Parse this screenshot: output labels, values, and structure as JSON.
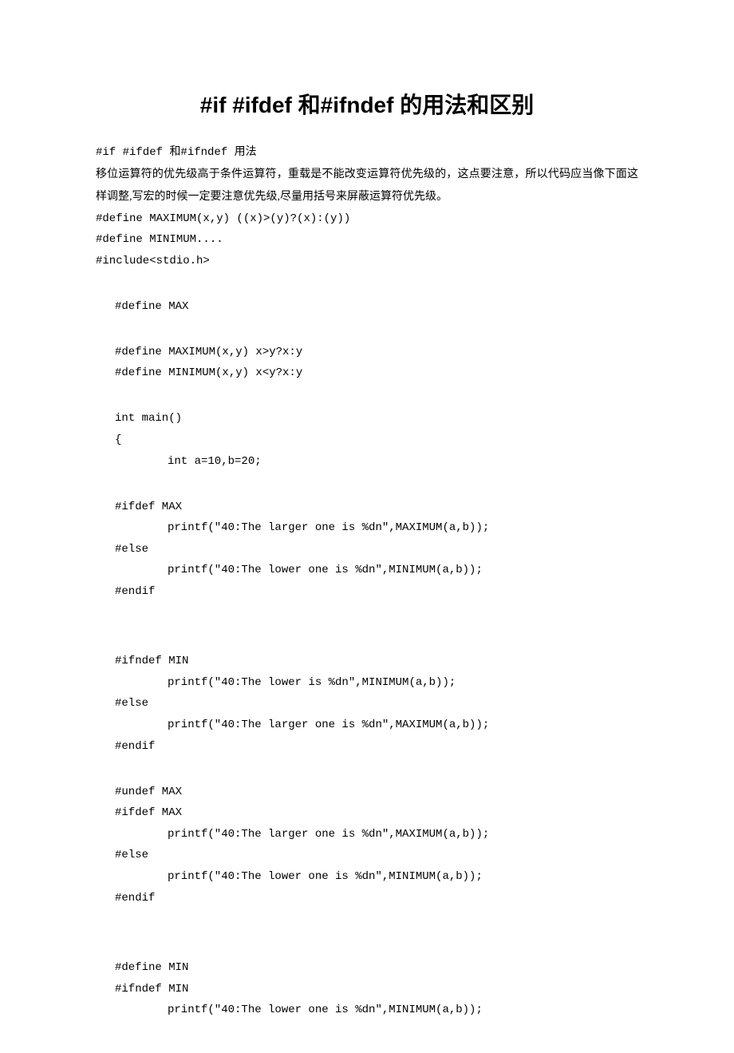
{
  "title": "#if #ifdef 和#ifndef 的用法和区别",
  "subtitle": "#if #ifdef 和#ifndef 用法",
  "para1": "移位运算符的优先级高于条件运算符，重载是不能改变运算符优先级的，这点要注意，所以代码应当像下面这样调整,写宏的时候一定要注意优先级,尽量用括号来屏蔽运算符优先级。",
  "c0": "#define MAXIMUM(x,y) ((x)>(y)?(x):(y))",
  "c1": "#define MINIMUM....",
  "c2": "#include<stdio.h>",
  "c3": "#define MAX",
  "c4": "#define MAXIMUM(x,y) x>y?x:y",
  "c5": "#define MINIMUM(x,y) x<y?x:y",
  "c6": "int main()",
  "c7": "{",
  "c8": "int a=10,b=20;",
  "c9": "#ifdef MAX",
  "c10": "printf(\"40:The larger one is %dn\",MAXIMUM(a,b));",
  "c11": "#else",
  "c12": "printf(\"40:The lower one is %dn\",MINIMUM(a,b));",
  "c13": "#endif",
  "c14": "#ifndef MIN",
  "c15": "printf(\"40:The lower is %dn\",MINIMUM(a,b));",
  "c16": "#else",
  "c17": "printf(\"40:The larger one is %dn\",MAXIMUM(a,b));",
  "c18": "#endif",
  "c19": "#undef MAX",
  "c20": "#ifdef MAX",
  "c21": "printf(\"40:The larger one is %dn\",MAXIMUM(a,b));",
  "c22": "#else",
  "c23": "printf(\"40:The lower one is %dn\",MINIMUM(a,b));",
  "c24": "#endif",
  "c25": "#define MIN",
  "c26": "#ifndef MIN",
  "c27": "printf(\"40:The lower one is %dn\",MINIMUM(a,b));"
}
